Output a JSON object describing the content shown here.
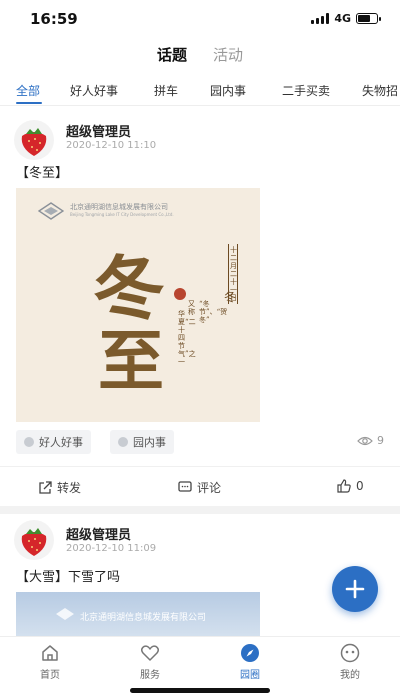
{
  "status_bar": {
    "time": "16:59",
    "network": "4G",
    "battery_level": 0.7
  },
  "top_tabs": [
    {
      "label": "话题",
      "active": true
    },
    {
      "label": "活动",
      "active": false
    }
  ],
  "categories": [
    {
      "label": "全部",
      "active": true
    },
    {
      "label": "好人好事",
      "active": false
    },
    {
      "label": "拼车",
      "active": false
    },
    {
      "label": "园内事",
      "active": false
    },
    {
      "label": "二手买卖",
      "active": false
    },
    {
      "label": "失物招",
      "active": false
    }
  ],
  "posts": [
    {
      "author": "超级管理员",
      "time": "2020-12-10 11:10",
      "text": "【冬至】",
      "image": {
        "company": "北京通明湖信息城发展有限公司",
        "company_en": "Beijing Tongming Lake IT City Development Co.,Ltd.",
        "title_big": "冬至",
        "date_vertical": "十二月二十一日",
        "season_char": "冬",
        "seal": "节气",
        "desc_col1": "又称",
        "desc_col2": "“冬节”、“贺冬”",
        "desc_col3": "华夏“二十四节气”之一"
      },
      "tags": [
        "好人好事",
        "园内事"
      ],
      "views": "9",
      "actions": {
        "share": "转发",
        "comment": "评论",
        "like": "0"
      }
    },
    {
      "author": "超级管理员",
      "time": "2020-12-10 11:09",
      "text": "【大雪】下雪了吗",
      "image": {
        "company": "北京通明湖信息城发展有限公司"
      }
    }
  ],
  "fab": {
    "icon": "plus-icon"
  },
  "bottom_nav": [
    {
      "label": "首页",
      "icon": "home-icon",
      "active": false
    },
    {
      "label": "服务",
      "icon": "heart-icon",
      "active": false
    },
    {
      "label": "园圈",
      "icon": "compass-icon",
      "active": true
    },
    {
      "label": "我的",
      "icon": "user-face-icon",
      "active": false
    }
  ],
  "colors": {
    "accent": "#2c6fc4",
    "poster_brown": "#7b5a2c",
    "seal_red": "#b8452f"
  }
}
